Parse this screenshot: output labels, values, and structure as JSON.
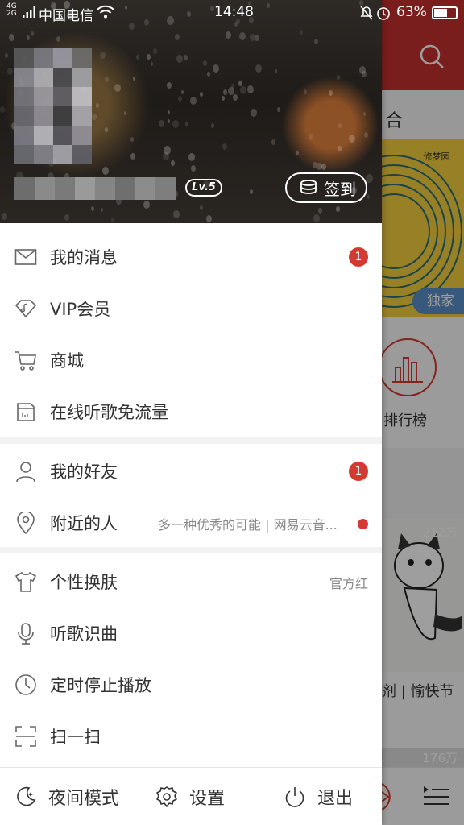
{
  "status_bar": {
    "network": "4G\n2G",
    "carrier": "中国电信",
    "time": "14:48",
    "battery": "63%",
    "battery_level": 0.63
  },
  "profile": {
    "level": "Lv.5",
    "checkin_label": "签到"
  },
  "menu": {
    "section1": [
      {
        "label": "我的消息",
        "badge": "1"
      },
      {
        "label": "VIP会员"
      },
      {
        "label": "商城"
      },
      {
        "label": "在线听歌免流量"
      }
    ],
    "section2": [
      {
        "label": "我的好友",
        "badge": "1"
      },
      {
        "label": "附近的人",
        "detail": "多一种优秀的可能 | 网易云音..."
      }
    ],
    "section3": [
      {
        "label": "个性换肤",
        "detail": "官方红"
      },
      {
        "label": "听歌识曲"
      },
      {
        "label": "定时停止播放"
      },
      {
        "label": "扫一扫"
      }
    ]
  },
  "bottom_bar": {
    "night_mode": "夜间模式",
    "settings": "设置",
    "logout": "退出"
  },
  "background": {
    "tab_partial": "合",
    "banner_logo": "修梦园",
    "exclusive_label": "独家",
    "rank_label": "排行榜",
    "card1_count": "212万",
    "card1_caption": "剂 | 愉快节",
    "card2_count": "176万"
  },
  "colors": {
    "accent": "#c62f2f",
    "badge": "#d33a31",
    "text": "#333333",
    "secondary_text": "#888888"
  }
}
